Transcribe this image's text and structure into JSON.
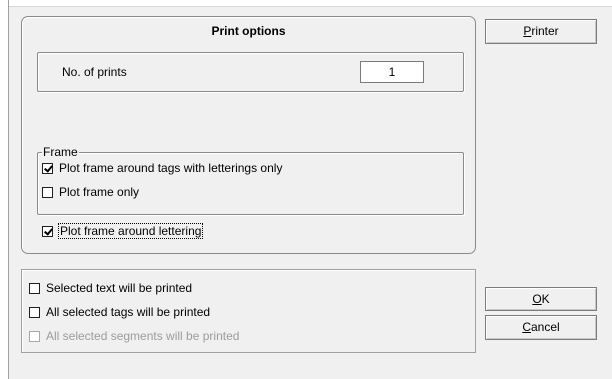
{
  "print_options": {
    "title": "Print options",
    "no_of_prints_label": "No. of prints",
    "no_of_prints_value": "1",
    "frame": {
      "legend": "Frame",
      "items": [
        {
          "label": "Plot frame around tags with letterings only",
          "checked": true
        },
        {
          "label": "Plot frame only",
          "checked": false
        }
      ]
    },
    "plot_frame_around_lettering": {
      "label": "Plot frame around lettering",
      "checked": true
    }
  },
  "selection": {
    "items": [
      {
        "label": "Selected text will be printed",
        "checked": false,
        "enabled": true
      },
      {
        "label": "All selected tags will be printed",
        "checked": false,
        "enabled": true
      },
      {
        "label": "All selected segments will be printed",
        "checked": false,
        "enabled": false
      }
    ]
  },
  "buttons": {
    "printer": {
      "accel": "P",
      "rest": "rinter"
    },
    "ok": {
      "accel": "O",
      "rest": "K"
    },
    "cancel": {
      "accel": "C",
      "rest": "ancel"
    }
  }
}
